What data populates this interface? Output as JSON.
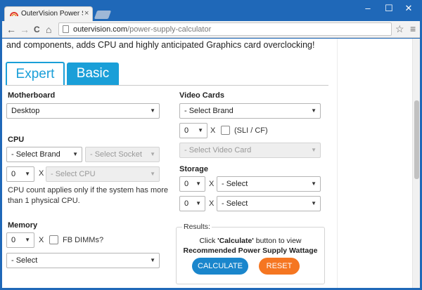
{
  "browser": {
    "tab_title": "OuterVision Power Supply",
    "tab_close": "×",
    "url_host": "outervision.com",
    "url_path": "/power-supply-calculator",
    "back": "←",
    "forward": "→",
    "reload": "C",
    "home": "⌂",
    "star": "☆",
    "menu": "≡",
    "window_minimize": "–",
    "window_maximize": "☐",
    "window_close": "✕"
  },
  "page": {
    "intro_text": "and components, adds CPU and highly anticipated Graphics card overclocking!",
    "tabs": {
      "expert": "Expert",
      "basic": "Basic"
    }
  },
  "motherboard": {
    "label": "Motherboard",
    "value": "Desktop"
  },
  "cpu": {
    "label": "CPU",
    "brand": "- Select Brand",
    "socket": "- Select Socket",
    "count": "0",
    "times": "X",
    "model": "- Select CPU",
    "note_line1": "CPU count applies only if the system has more",
    "note_line2": "than 1 physical CPU."
  },
  "memory": {
    "label": "Memory",
    "count": "0",
    "times": "X",
    "fb_dimms": "FB DIMMs?",
    "module": "- Select"
  },
  "video": {
    "label": "Video Cards",
    "brand": "- Select Brand",
    "count": "0",
    "times": "X",
    "sli": "(SLI / CF)",
    "card": "- Select Video Card"
  },
  "storage": {
    "label": "Storage",
    "rows": [
      {
        "count": "0",
        "times": "X",
        "type": "- Select"
      },
      {
        "count": "0",
        "times": "X",
        "type": "- Select"
      }
    ]
  },
  "results": {
    "legend": "Results:",
    "line1_prefix": "Click ",
    "line1_bold": "'Calculate'",
    "line1_suffix": " button to view",
    "line2": "Recommended Power Supply Wattage",
    "calculate": "CALCULATE",
    "reset": "RESET"
  },
  "colors": {
    "window_frame": "#1f68b8",
    "tab_accent": "#1a9fd8",
    "calculate_button": "#1a86cc",
    "reset_button": "#f57621"
  }
}
